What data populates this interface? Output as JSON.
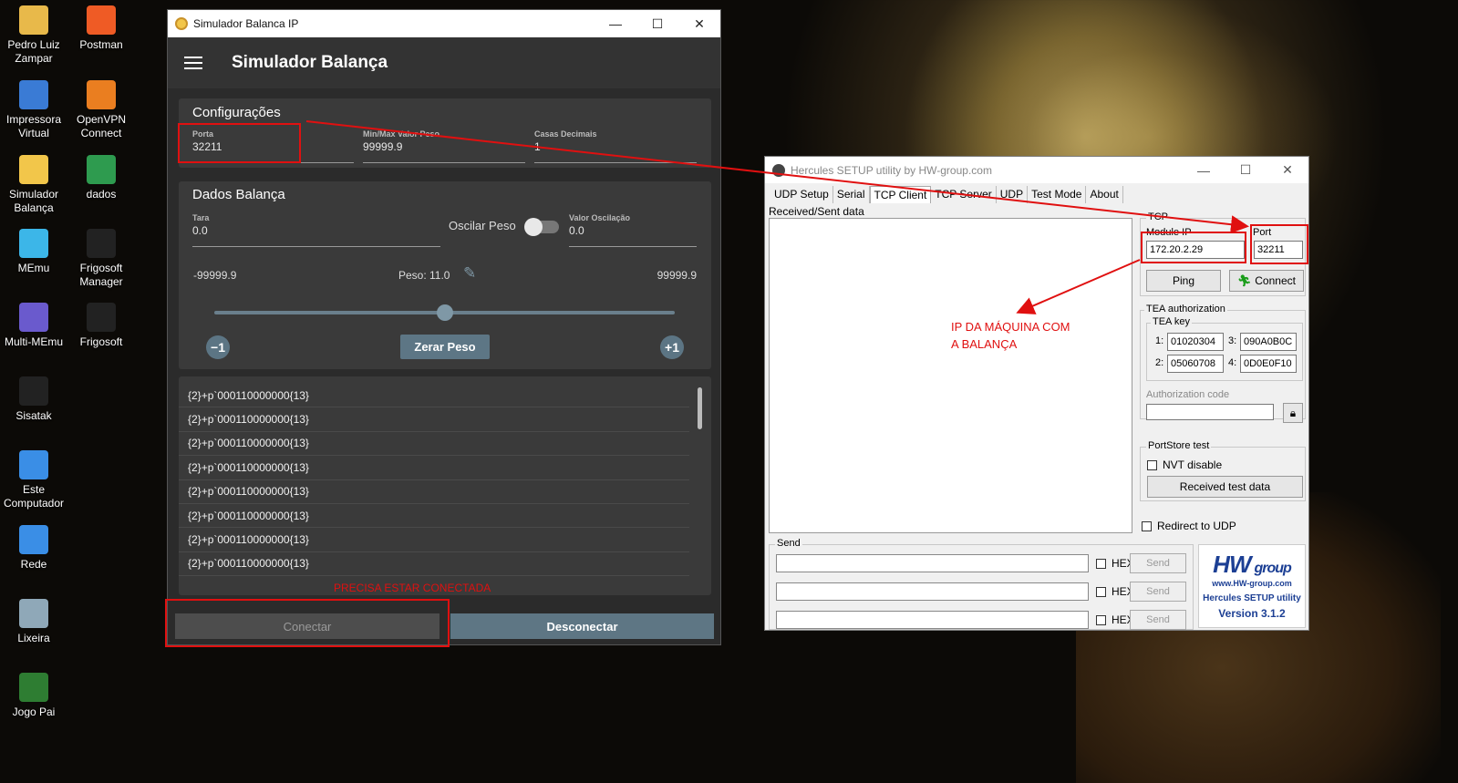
{
  "desktop": {
    "icons": [
      {
        "label": "Pedro Luiz Zampar",
        "icon": "user-folder-icon",
        "color": "#e8b94a"
      },
      {
        "label": "Postman",
        "icon": "postman-icon",
        "color": "#ef5b25"
      },
      {
        "label": "Impressora Virtual",
        "icon": "printer-icon",
        "color": "#3a7bd5"
      },
      {
        "label": "OpenVPN Connect",
        "icon": "openvpn-icon",
        "color": "#ea7e20"
      },
      {
        "label": "Simulador Balança",
        "icon": "scale-app-icon",
        "color": "#f2c64a"
      },
      {
        "label": "dados",
        "icon": "spreadsheet-icon",
        "color": "#2e9b4f"
      },
      {
        "label": "MEmu",
        "icon": "memu-icon",
        "color": "#3cb6e8"
      },
      {
        "label": "Frigosoft Manager",
        "icon": "frigosoft-icon",
        "color": "#222222"
      },
      {
        "label": "Multi-MEmu",
        "icon": "multi-memu-icon",
        "color": "#6a5acd"
      },
      {
        "label": "Frigosoft",
        "icon": "frigosoft-icon",
        "color": "#222222"
      },
      {
        "label": "Sisatak",
        "icon": "sisatak-icon",
        "color": "#222222"
      },
      {
        "label": "Este Computador",
        "icon": "computer-icon",
        "color": "#3a8ee6"
      },
      {
        "label": "Rede",
        "icon": "network-icon",
        "color": "#3a8ee6"
      },
      {
        "label": "Lixeira",
        "icon": "recycle-bin-icon",
        "color": "#8fa8b8"
      },
      {
        "label": "Jogo Pai",
        "icon": "game-icon",
        "color": "#2e7d32"
      }
    ]
  },
  "simulador": {
    "window_title": "Simulador Balanca IP",
    "app_title": "Simulador Balança",
    "config": {
      "title": "Configurações",
      "porta_label": "Porta",
      "porta_value": "32211",
      "minmax_label": "Min/Max Valor Peso",
      "minmax_value": "99999.9",
      "casas_label": "Casas Decimais",
      "casas_value": "1"
    },
    "dados": {
      "title": "Dados Balança",
      "tara_label": "Tara",
      "tara_value": "0.0",
      "oscilar_label": "Oscilar Peso",
      "oscilar_on": false,
      "valor_osc_label": "Valor Oscilação",
      "valor_osc_value": "0.0",
      "min_value": "-99999.9",
      "peso_text": "Peso: 11.0",
      "max_value": "99999.9",
      "slider_fraction": 0.5,
      "minus_label": "−1",
      "zerar_label": "Zerar Peso",
      "plus_label": "+1"
    },
    "log_lines": [
      "{2}+p`000110000000{13}",
      "{2}+p`000110000000{13}",
      "{2}+p`000110000000{13}",
      "{2}+p`000110000000{13}",
      "{2}+p`000110000000{13}",
      "{2}+p`000110000000{13}",
      "{2}+p`000110000000{13}",
      "{2}+p`000110000000{13}"
    ],
    "conectar_label": "Conectar",
    "desconectar_label": "Desconectar"
  },
  "annotations": {
    "precisa": "PRECISA ESTAR CONECTADA",
    "ip_line1": "IP DA MÁQUINA COM",
    "ip_line2": "A BALANÇA",
    "color": "#e01010"
  },
  "hercules": {
    "window_title": "Hercules SETUP utility by HW-group.com",
    "tabs": [
      "UDP Setup",
      "Serial",
      "TCP Client",
      "TCP Server",
      "UDP",
      "Test Mode",
      "About"
    ],
    "active_tab": "TCP Client",
    "received_label": "Received/Sent data",
    "tcp_group": "TCP",
    "module_ip_label": "Module IP",
    "module_ip_value": "172.20.2.29",
    "port_label": "Port",
    "port_value": "32211",
    "ping_label": "Ping",
    "connect_label": "Connect",
    "tea_group": "TEA authorization",
    "tea_key_label": "TEA key",
    "tea_keys": [
      {
        "n": "1:",
        "v": "01020304"
      },
      {
        "n": "3:",
        "v": "090A0B0C"
      },
      {
        "n": "2:",
        "v": "05060708"
      },
      {
        "n": "4:",
        "v": "0D0E0F10"
      }
    ],
    "auth_code_label": "Authorization code",
    "portstore_group": "PortStore test",
    "nvt_label": "NVT disable",
    "received_test_label": "Received test data",
    "redirect_label": "Redirect to UDP",
    "send_group": "Send",
    "hex_label": "HEX",
    "send_label": "Send",
    "logo_hw": "HW",
    "logo_group": "group",
    "logo_url": "www.HW-group.com",
    "logo_product": "Hercules SETUP utility",
    "logo_version": "Version  3.1.2"
  }
}
